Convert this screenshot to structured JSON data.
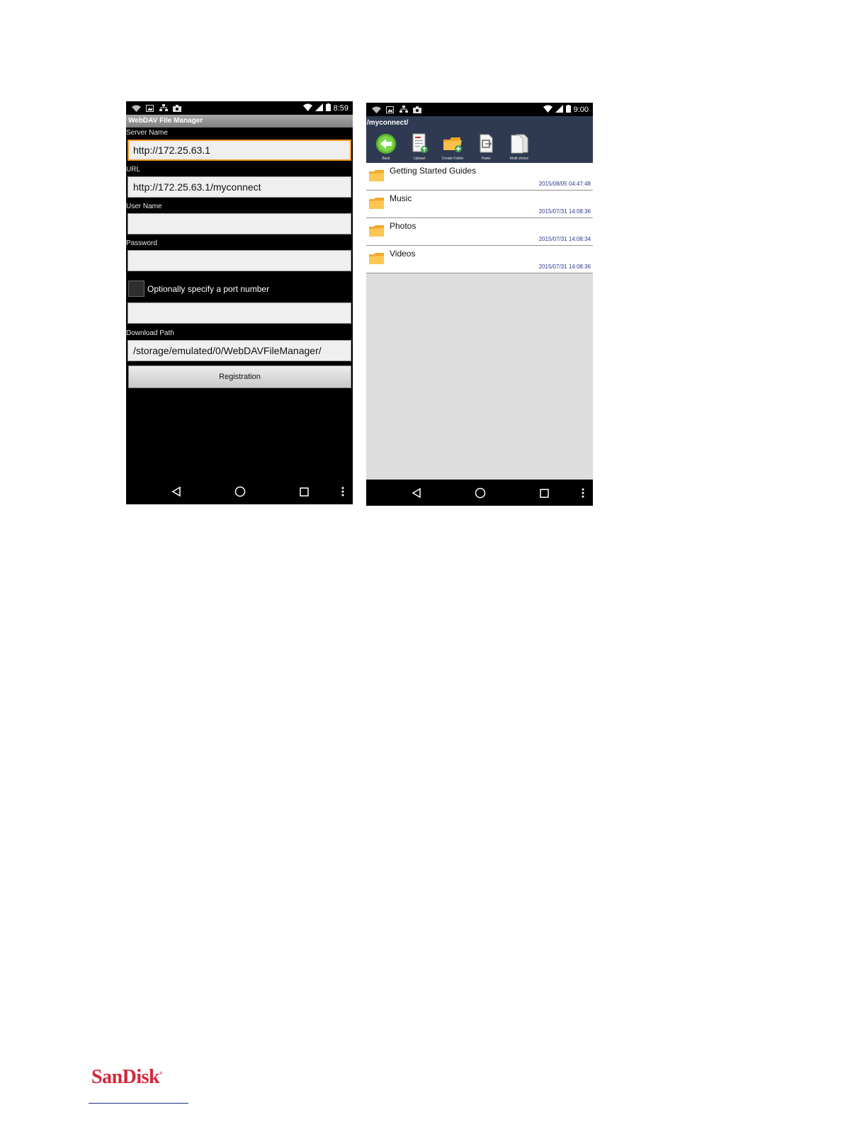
{
  "phone1": {
    "status_time": "8:59",
    "app_title": "WebDAV File Manager",
    "fields": [
      {
        "label": "Server Name",
        "value": "http://172.25.63.1"
      },
      {
        "label": "URL",
        "value": "http://172.25.63.1/myconnect"
      },
      {
        "label": "User Name",
        "value": ""
      },
      {
        "label": "Password",
        "value": ""
      }
    ],
    "port_checkbox_label": "Optionally specify a port number",
    "port_value": "",
    "download_path_label": "Download Path",
    "download_path_value": "/storage/emulated/0/WebDAVFileManager/",
    "registration_button": "Registration"
  },
  "phone2": {
    "status_time": "9:00",
    "path": "/myconnect/",
    "toolbar": [
      {
        "label": "Back",
        "icon": "back-arrow-icon"
      },
      {
        "label": "Upload",
        "icon": "upload-icon"
      },
      {
        "label": "Create Folder",
        "icon": "create-folder-icon"
      },
      {
        "label": "Paste",
        "icon": "paste-icon"
      },
      {
        "label": "Multi choice",
        "icon": "multi-choice-icon"
      }
    ],
    "items": [
      {
        "name": "Getting Started Guides",
        "date": "2015/08/05 04:47:48"
      },
      {
        "name": "Music",
        "date": "2015/07/31 14:08:36"
      },
      {
        "name": "Photos",
        "date": "2015/07/31 14:08:34"
      },
      {
        "name": "Videos",
        "date": "2015/07/31 14:08:36"
      }
    ]
  },
  "footer": {
    "brand": "SanDisk",
    "brand_mark": "®"
  },
  "colors": {
    "focus_orange": "#f0962b",
    "header_navy": "#2f3a52",
    "date_blue": "#2f3a86",
    "brand_red": "#d4283a"
  }
}
